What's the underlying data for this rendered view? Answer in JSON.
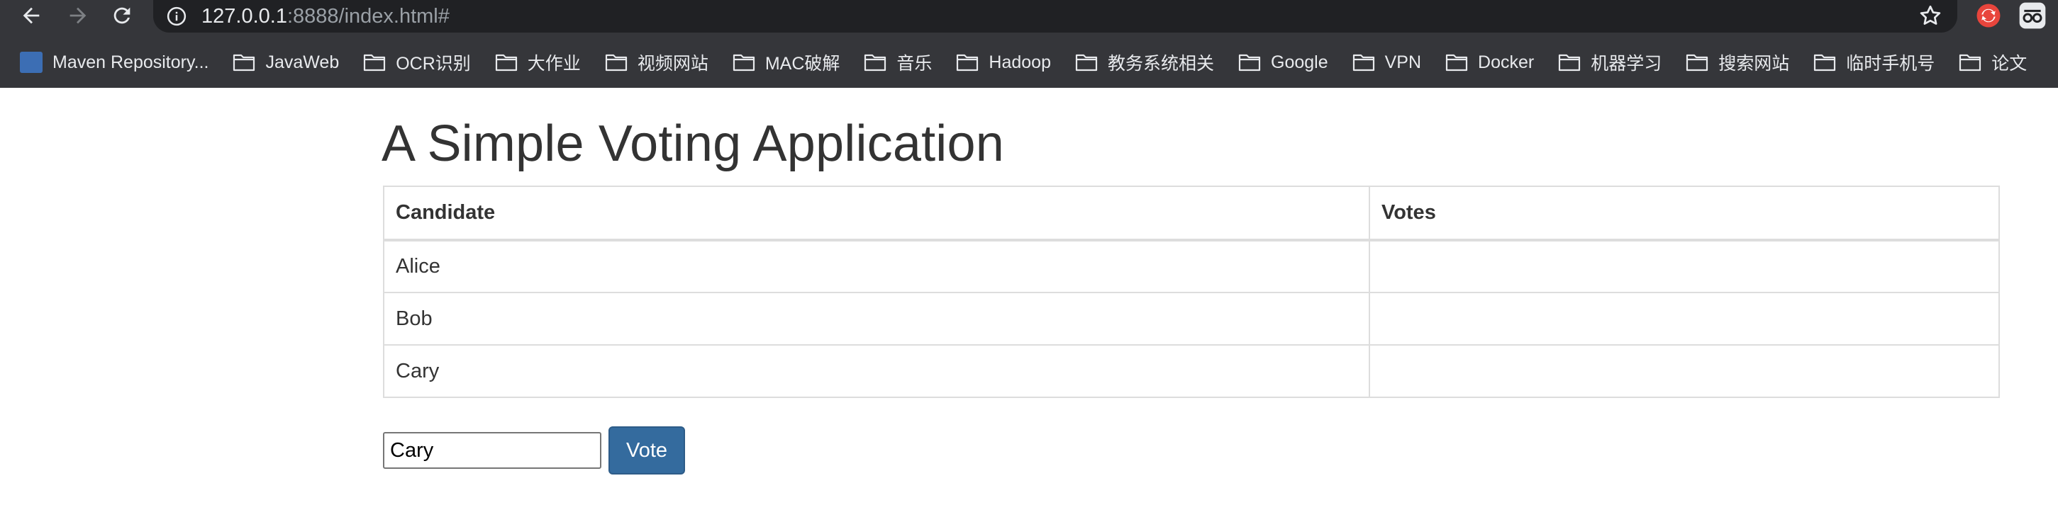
{
  "browser": {
    "url_host": "127.0.0.1",
    "url_rest": ":8888/index.html#",
    "bookmarks": [
      {
        "label": "Maven Repository...",
        "icon": "maven-logo"
      },
      {
        "label": "JavaWeb",
        "icon": "folder-icon"
      },
      {
        "label": "OCR识别",
        "icon": "folder-icon"
      },
      {
        "label": "大作业",
        "icon": "folder-icon"
      },
      {
        "label": "视频网站",
        "icon": "folder-icon"
      },
      {
        "label": "MAC破解",
        "icon": "folder-icon"
      },
      {
        "label": "音乐",
        "icon": "folder-icon"
      },
      {
        "label": "Hadoop",
        "icon": "folder-icon"
      },
      {
        "label": "教务系统相关",
        "icon": "folder-icon"
      },
      {
        "label": "Google",
        "icon": "folder-icon"
      },
      {
        "label": "VPN",
        "icon": "folder-icon"
      },
      {
        "label": "Docker",
        "icon": "folder-icon"
      },
      {
        "label": "机器学习",
        "icon": "folder-icon"
      },
      {
        "label": "搜索网站",
        "icon": "folder-icon"
      },
      {
        "label": "临时手机号",
        "icon": "folder-icon"
      },
      {
        "label": "论文",
        "icon": "folder-icon"
      }
    ]
  },
  "page": {
    "title": "A Simple Voting Application",
    "table": {
      "headers": [
        "Candidate",
        "Votes"
      ],
      "rows": [
        {
          "candidate": "Alice",
          "votes": ""
        },
        {
          "candidate": "Bob",
          "votes": ""
        },
        {
          "candidate": "Cary",
          "votes": ""
        }
      ]
    },
    "form": {
      "input_value": "Cary",
      "button_label": "Vote"
    }
  },
  "colors": {
    "chrome_bg": "#35363a",
    "omnibox_bg": "#202124",
    "button_bg": "#346b9e",
    "text": "#333333"
  }
}
